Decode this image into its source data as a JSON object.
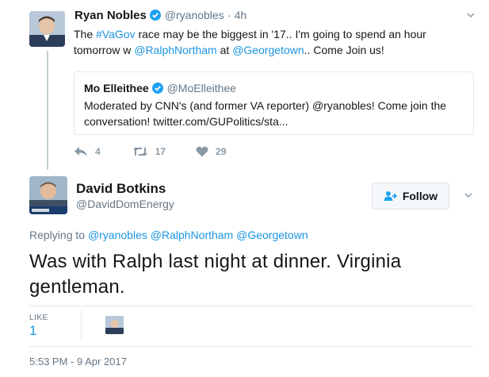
{
  "parent_tweet": {
    "author_name": "Ryan Nobles",
    "author_handle": "@ryanobles",
    "time": "· 4h",
    "text_parts": {
      "p1": "The ",
      "hashtag": "#VaGov",
      "p2": " race may be the biggest in '17.. I'm going to spend an hour",
      "p3": "tomorrow w ",
      "mention1": "@RalphNortham",
      "p4": " at ",
      "mention2": "@Georgetown",
      "p5": ".. Come Join us!"
    },
    "quoted": {
      "author_name": "Mo Elleithee",
      "author_handle": "@MoElleithee",
      "line1": "Moderated by CNN's (and former VA reporter) @ryanobles!  Come join the",
      "line2": "conversation! twitter.com/GUPolitics/sta..."
    },
    "actions": {
      "reply_count": "4",
      "retweet_count": "17",
      "like_count": "29"
    }
  },
  "main_tweet": {
    "author_name": "David Botkins",
    "author_handle": "@DavidDomEnergy",
    "follow_label": "Follow",
    "replying_to": {
      "prefix": "Replying to ",
      "m1": "@ryanobles",
      "m2": "@RalphNortham",
      "m3": "@Georgetown"
    },
    "text_line1": "Was with Ralph last night at dinner. Virginia",
    "text_line2": "gentleman.",
    "likes_label": "LIKE",
    "likes_count": "1",
    "timestamp": "5:53 PM - 9 Apr 2017"
  },
  "colors": {
    "link": "#1b95e0",
    "muted": "#657786",
    "verified": "#1da1f2"
  },
  "icons": [
    "verified-icon",
    "chevron-down-icon",
    "reply-icon",
    "retweet-icon",
    "heart-icon",
    "add-user-icon"
  ]
}
